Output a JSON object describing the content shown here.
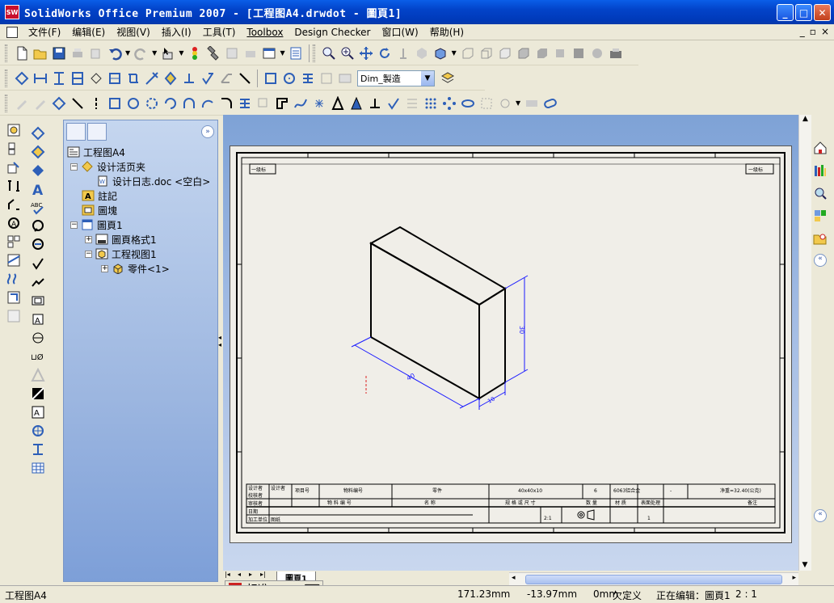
{
  "window": {
    "title": "SolidWorks Office Premium 2007 - [工程图A4.drwdot - 圖頁1]",
    "logo_text": "SW",
    "minimize": "_",
    "maximize": "□",
    "close": "✕"
  },
  "menu": {
    "items": [
      "文件(F)",
      "编辑(E)",
      "视图(V)",
      "插入(I)",
      "工具(T)",
      "Toolbox",
      "Design Checker",
      "窗口(W)",
      "帮助(H)"
    ],
    "mdi_minimize": "_",
    "mdi_restore": "▫",
    "mdi_close": "×"
  },
  "toolbar3": {
    "layer_combo": "Dim_製造"
  },
  "feature_tree": {
    "root": "工程图A4",
    "design_folder": "设计活页夹",
    "design_log": "设计日志.doc <空白>",
    "annotations": "註記",
    "blocks": "圖塊",
    "sheet": "圖頁1",
    "sheet_format": "圖頁格式1",
    "drawing_view": "工程视图1",
    "part": "零件<1>"
  },
  "drawing": {
    "dim_height": "30",
    "dim_length": "40",
    "dim_depth": "10",
    "tb_design": "设计者",
    "tb_check": "校核者",
    "tb_approve": "审核者",
    "tb_item_no": "项目号",
    "tb_material_no": "物料编号",
    "tb_part": "零件",
    "tb_spec": "40x40x10",
    "tb_qty": "6",
    "tb_material": "6063铝合金",
    "tb_dash": "-",
    "tb_weight": "净重=32.40(公克)",
    "tb_header_material_no": "物 料 编 号",
    "tb_header_name": "名 称",
    "tb_header_spec": "规 格 或 尺 寸",
    "tb_header_qty": "数 量",
    "tb_header_mat": "材 质",
    "tb_header_finish": "表面处理",
    "tb_header_remark": "备注",
    "tb_scale": "2:1",
    "tb_sheet_count": "1",
    "tb_date": "日期",
    "tb_unit": "加工单位",
    "tb_process": "图纸",
    "tb_label_left": "一级标",
    "tb_label_right": "一级标"
  },
  "sheet_tabs": {
    "active": "圖頁1"
  },
  "ime": {
    "mode": "标准",
    "moon": "◐",
    "punct": "•,"
  },
  "status": {
    "left": "工程图A4",
    "x": "171.23mm",
    "y": "-13.97mm",
    "z": "0mm",
    "def": "欠定义",
    "editing": "正在编辑：圖頁1",
    "scale": "2 : 1"
  }
}
